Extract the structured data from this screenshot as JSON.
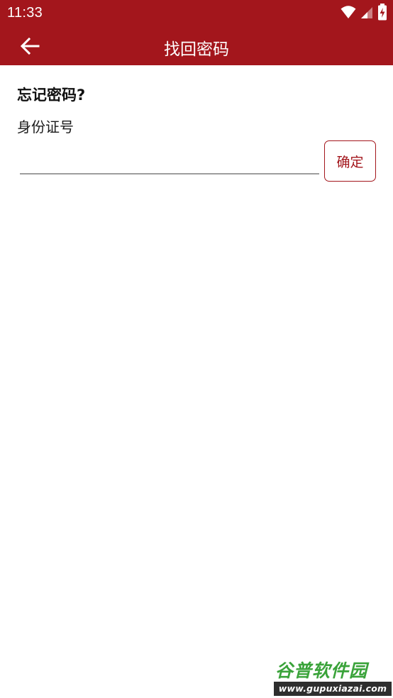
{
  "status_bar": {
    "time": "11:33",
    "icons": [
      "wifi-icon",
      "cell-signal-icon",
      "battery-charging-icon"
    ]
  },
  "app_bar": {
    "back_icon": "arrow-left-icon",
    "title": "找回密码"
  },
  "form": {
    "heading": "忘记密码?",
    "id_label": "身份证号",
    "id_value": "",
    "confirm_label": "确定"
  },
  "watermark": {
    "name": "谷普软件园",
    "url": "www.gupuxiazai.com"
  },
  "colors": {
    "primary": "#a3161c",
    "background": "#ffffff",
    "underline": "#9e9e9e"
  }
}
